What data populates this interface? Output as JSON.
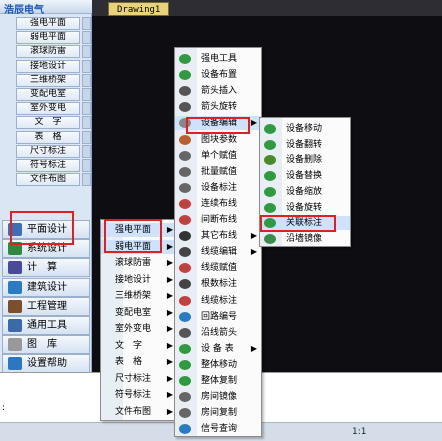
{
  "app": {
    "panel_title": "浩辰电气",
    "drawing_tab": "Drawing1",
    "cmd_prompt": ":"
  },
  "left_panel": {
    "top_items": [
      "强电平面",
      "弱电平面",
      "滚球防雷",
      "接地设计",
      "三维桥架",
      "变配电室",
      "室外变电",
      "文　字",
      "表　格",
      "尺寸标注",
      "符号标注",
      "文件布图"
    ],
    "big_buttons": [
      "平面设计",
      "系统设计",
      "计　算",
      "建筑设计",
      "工程管理",
      "通用工具",
      "图　库",
      "设置帮助"
    ]
  },
  "menu1": {
    "items": [
      "强电平面",
      "弱电平面",
      "滚球防雷",
      "接地设计",
      "三维桥架",
      "变配电室",
      "室外变电",
      "文　字",
      "表　格",
      "尺寸标注",
      "符号标注",
      "文件布图"
    ]
  },
  "menu2": {
    "items": [
      "强电工具",
      "设备布置",
      "箭头插入",
      "箭头旋转",
      "设备编辑",
      "图块参数",
      "单个赋值",
      "批量赋值",
      "设备标注",
      "连续布线",
      "间断布线",
      "其它布线",
      "线缆编辑",
      "线缆赋值",
      "根数标注",
      "线缆标注",
      "回路编号",
      "沿线箭头",
      "设 备 表",
      "整体移动",
      "整体复制",
      "房间镜像",
      "房间复制",
      "信号查询"
    ]
  },
  "menu3": {
    "items": [
      "设备移动",
      "设备翻转",
      "设备删除",
      "设备替换",
      "设备缩放",
      "设备旋转",
      "关联标注",
      "沿墙镜像"
    ]
  },
  "status": {
    "scale": "1:1",
    "items": [
      "▦",
      "▦",
      "▦",
      "L",
      "⊡",
      "+",
      "▲",
      "◉"
    ]
  },
  "colors": {
    "highlight": "#cfe2fb",
    "red_box": "#e02020",
    "drawing_bg": "#0e0e12",
    "panel_title": "#1a58b8"
  }
}
